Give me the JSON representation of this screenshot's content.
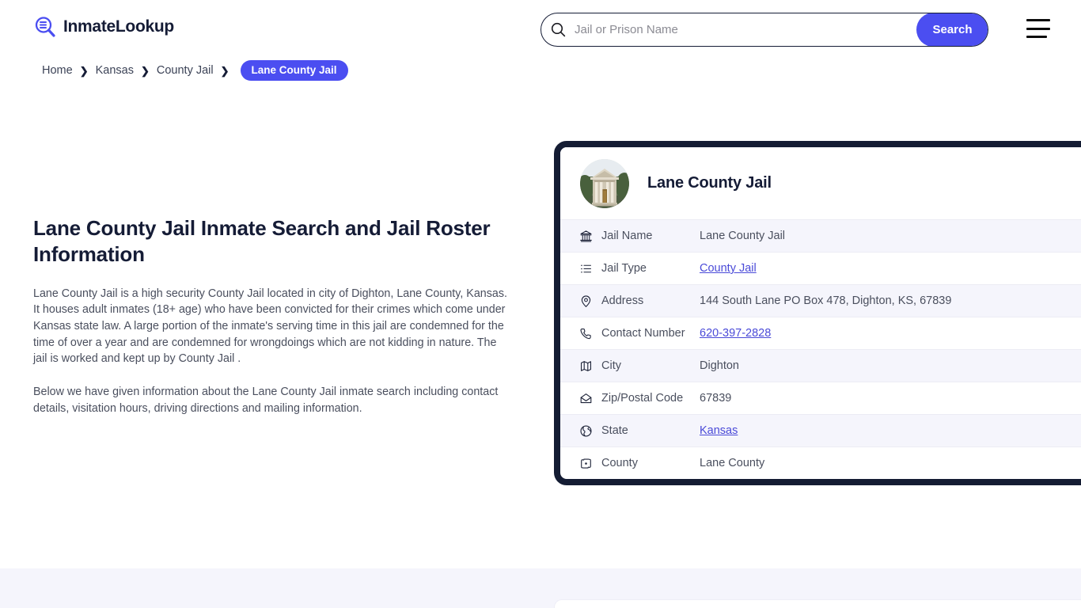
{
  "site": {
    "brand_name": "InmateLookup",
    "brand_icon": "search-list-icon"
  },
  "search": {
    "placeholder": "Jail or Prison Name",
    "value": "",
    "button_label": "Search",
    "icon": "search-icon"
  },
  "menu": {
    "icon": "hamburger-icon"
  },
  "breadcrumb": {
    "items": [
      {
        "label": "Home",
        "current": false
      },
      {
        "label": "Kansas",
        "current": false
      },
      {
        "label": "County Jail",
        "current": false
      },
      {
        "label": "Lane County Jail",
        "current": true
      }
    ],
    "separator": "❯"
  },
  "article": {
    "heading": "Lane County Jail Inmate Search and Jail Roster Information",
    "paragraph1": "Lane County Jail is a high security County Jail located in city of Dighton, Lane County, Kansas. It houses adult inmates (18+ age) who have been convicted for their crimes which come under Kansas state law. A large portion of the inmate's serving time in this jail are condemned for the time of over a year and are condemned for wrongdoings which are not kidding in nature. The jail is worked and kept up by County Jail .",
    "paragraph2": "Below we have given information about the Lane County Jail inmate search including contact details, visitation hours, driving directions and mailing information."
  },
  "info_card": {
    "title": "Lane County Jail",
    "avatar_alt": "courthouse-photo",
    "rows": [
      {
        "icon": "bank-icon",
        "label": "Jail Name",
        "value": "Lane County Jail",
        "link": false
      },
      {
        "icon": "list-icon",
        "label": "Jail Type",
        "value": "County Jail",
        "link": true
      },
      {
        "icon": "map-pin-icon",
        "label": "Address",
        "value": "144 South Lane PO Box 478, Dighton, KS, 67839",
        "link": false
      },
      {
        "icon": "phone-icon",
        "label": "Contact Number",
        "value": "620-397-2828",
        "link": true
      },
      {
        "icon": "map-icon",
        "label": "City",
        "value": "Dighton",
        "link": false
      },
      {
        "icon": "envelope-icon",
        "label": "Zip/Postal Code",
        "value": "67839",
        "link": false
      },
      {
        "icon": "globe-icon",
        "label": "State",
        "value": "Kansas",
        "link": true
      },
      {
        "icon": "county-icon",
        "label": "County",
        "value": "Lane County",
        "link": false
      }
    ]
  },
  "colors": {
    "accent": "#4b4ef1",
    "dark": "#141c33",
    "link": "#4a4ad8",
    "row_alt": "#f5f5fc",
    "band": "#f5f5fc"
  }
}
